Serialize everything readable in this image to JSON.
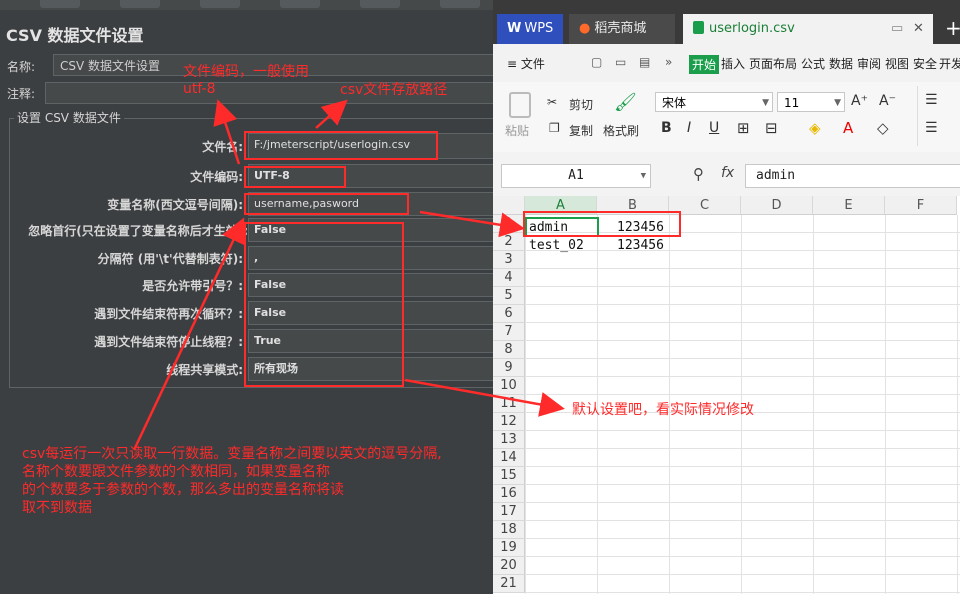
{
  "jmeter": {
    "title": "CSV 数据文件设置",
    "name_label": "名称:",
    "name_value": "CSV 数据文件设置",
    "comment_label": "注释:",
    "section_title": "设置 CSV 数据文件",
    "rows": [
      {
        "label": "文件名:",
        "value": "F:/jmeterscript/userlogin.csv"
      },
      {
        "label": "文件编码:",
        "value": "UTF-8"
      },
      {
        "label": "变量名称(西文逗号间隔):",
        "value": "username,pasword"
      },
      {
        "label": "忽略首行(只在设置了变量名称后才生效):",
        "value": "False"
      },
      {
        "label": "分隔符 (用'\\t'代替制表符):",
        "value": ","
      },
      {
        "label": "是否允许带引号？:",
        "value": "False"
      },
      {
        "label": "遇到文件结束符再次循环？:",
        "value": "False"
      },
      {
        "label": "遇到文件结束符停止线程？:",
        "value": "True"
      },
      {
        "label": "线程共享模式:",
        "value": "所有现场"
      }
    ]
  },
  "annotations": {
    "encoding_note": "文件编码，一般使用",
    "encoding_value": "utf-8",
    "path_note": "csv文件存放路径",
    "default_note": "默认设置吧，看实际情况修改",
    "explain_lines": [
      "csv每运行一次只读取一行数据。变量名称之间要以英文的逗号分隔,",
      "名称个数要跟文件参数的个数相同，如果变量名称",
      "的个数要多于参数的个数，那么多出的变量名称将读",
      "取不到数据"
    ]
  },
  "wps": {
    "tabs": [
      "WPS",
      "稻壳商城",
      "userlogin.csv"
    ],
    "menu": [
      "≡ 文件",
      "开始",
      "插入",
      "页面布局",
      "公式",
      "数据",
      "审阅",
      "视图",
      "安全",
      "开发"
    ],
    "ribbon": {
      "paste": "粘贴",
      "cut": "剪切",
      "copy": "复制",
      "format_painter": "格式刷",
      "font": "宋体",
      "size": "11"
    },
    "cell_ref": "A1",
    "fx": "fx",
    "formula_value": "admin",
    "columns": [
      "A",
      "B",
      "C",
      "D",
      "E",
      "F"
    ],
    "rows": [
      "1",
      "2",
      "3",
      "4",
      "5",
      "6",
      "7",
      "8",
      "9",
      "10",
      "11",
      "12",
      "13",
      "14",
      "15",
      "16",
      "17",
      "18",
      "19",
      "20",
      "21"
    ],
    "cells": [
      {
        "a": "admin",
        "b": "123456"
      },
      {
        "a": "test_02",
        "b": "123456"
      }
    ]
  }
}
